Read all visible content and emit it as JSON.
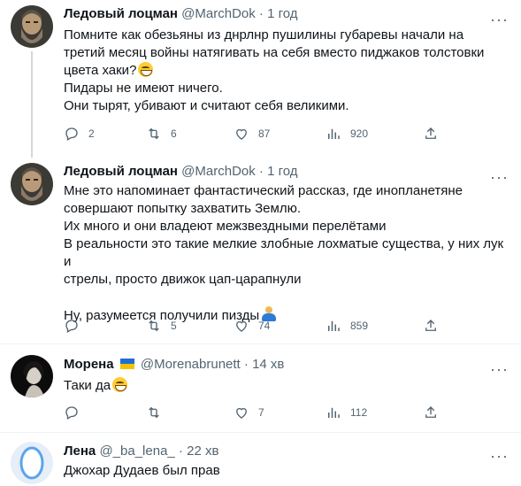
{
  "tweets": [
    {
      "name": "Ледовый лоцман",
      "handle": "@MarchDok",
      "separator": "·",
      "time": "1 год",
      "lines": [
        "Помните как обезьяны из днрлнр пушилины губаревы начали на",
        "третий месяц войны натягивать на себя вместо пиджаков толстовки",
        "цвета хаки?",
        "Пидары не имеют ничего.",
        "Они тырят, убивают и считают себя великими."
      ],
      "emoji": "grinning-face",
      "stats": {
        "replies": "2",
        "retweets": "6",
        "likes": "87",
        "views": "920"
      }
    },
    {
      "name": "Ледовый лоцман",
      "handle": "@MarchDok",
      "separator": "·",
      "time": "1 год",
      "lines": [
        "Мне это напоминает фантастический рассказ, где инопланетяне",
        "совершают попытку захватить Землю.",
        "Их много и они владеют межзвездными перелётами",
        "В реальности это такие мелкие злобные лохматые существа, у них лук и",
        "стрелы, просто движок цап-царапнули",
        "Ну, разумеется получили пизды"
      ],
      "emoji": "shrugging-person",
      "stats": {
        "replies": "",
        "retweets": "5",
        "likes": "74",
        "views": "859"
      }
    },
    {
      "name": "Морена",
      "handle": "@Morenabrunett",
      "separator": "·",
      "time": "14 хв",
      "flag_colors": [
        "#1f6fd1",
        "#f2c200"
      ],
      "lines": [
        "Таки да"
      ],
      "emoji": "grinning-face",
      "stats": {
        "replies": "",
        "retweets": "",
        "likes": "7",
        "views": "112"
      }
    },
    {
      "name": "Лена",
      "handle": "@_ba_lena_",
      "separator": "·",
      "time": "22 хв",
      "lines": [
        "Джохар Дудаев был прав"
      ]
    }
  ],
  "icons": {
    "more": "more-horizontal-icon",
    "reply": "reply-icon",
    "retweet": "retweet-icon",
    "like": "heart-icon",
    "views": "views-icon",
    "share": "share-icon"
  },
  "more_glyph": "···",
  "colors": {
    "text": "#0f1419",
    "secondary": "#536471",
    "line": "#cfd9de",
    "divider": "#eff3f4"
  }
}
